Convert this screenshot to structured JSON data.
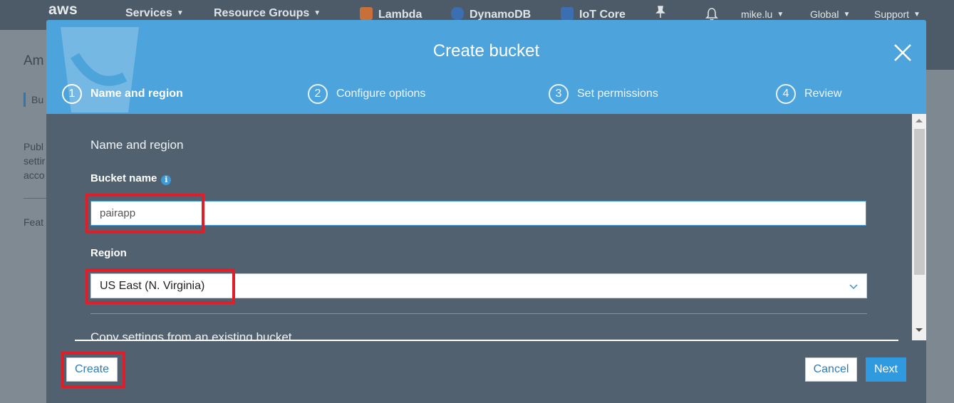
{
  "nav": {
    "logo": "aws",
    "services": "Services",
    "resource_groups": "Resource Groups",
    "shortcuts": [
      "Lambda",
      "DynamoDB",
      "IoT Core"
    ],
    "user": "mike.lu",
    "region": "Global",
    "support": "Support"
  },
  "background": {
    "title_fragment": "Am",
    "tab_fragment": "Bu",
    "para_fragment": [
      "Publ",
      "settir",
      "acco"
    ],
    "feat_fragment": "Feat"
  },
  "modal": {
    "title": "Create bucket",
    "steps": [
      {
        "num": "1",
        "label": "Name and region"
      },
      {
        "num": "2",
        "label": "Configure options"
      },
      {
        "num": "3",
        "label": "Set permissions"
      },
      {
        "num": "4",
        "label": "Review"
      }
    ],
    "section_title": "Name and region",
    "bucket_name_label": "Bucket name",
    "bucket_name_value": "pairapp",
    "region_label": "Region",
    "region_value": "US East (N. Virginia)",
    "copy_settings": "Copy settings from an existing bucket",
    "buttons": {
      "create": "Create",
      "cancel": "Cancel",
      "next": "Next"
    }
  },
  "colors": {
    "header_blue": "#4da4dc",
    "modal_body": "#516170",
    "primary_button": "#2f9ae0",
    "highlight_red": "#e01e2a"
  }
}
